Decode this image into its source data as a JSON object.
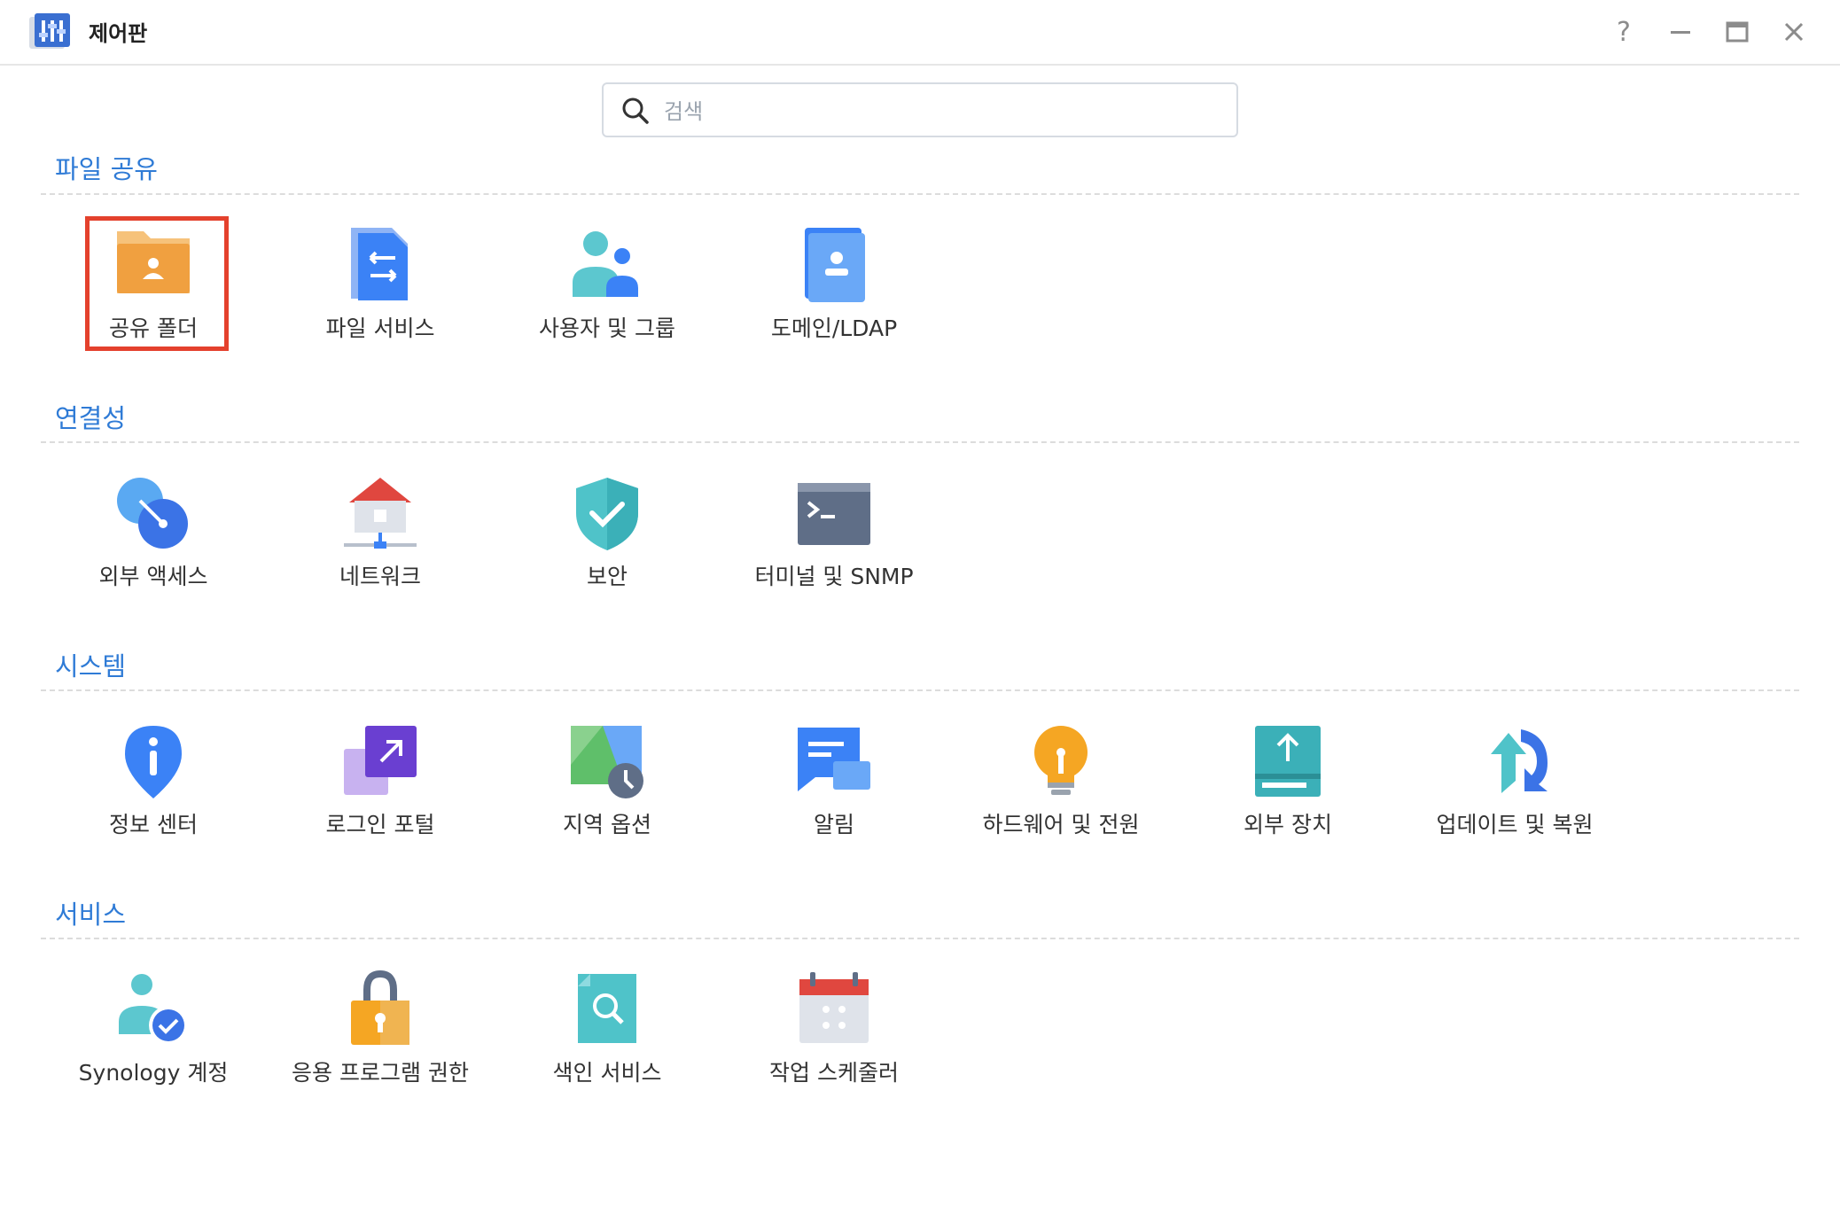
{
  "window": {
    "title": "제어판",
    "controls": [
      "help",
      "minimize",
      "maximize",
      "close"
    ],
    "help_label": "?"
  },
  "search": {
    "placeholder": "검색",
    "value": ""
  },
  "sections": [
    {
      "title": "파일 공유",
      "items": [
        {
          "label": "공유 폴더",
          "icon": "shared-folder-icon",
          "selected": true
        },
        {
          "label": "파일 서비스",
          "icon": "file-services-icon"
        },
        {
          "label": "사용자 및 그룹",
          "icon": "user-group-icon"
        },
        {
          "label": "도메인/LDAP",
          "icon": "domain-ldap-icon"
        }
      ]
    },
    {
      "title": "연결성",
      "items": [
        {
          "label": "외부 액세스",
          "icon": "external-access-icon"
        },
        {
          "label": "네트워크",
          "icon": "network-icon"
        },
        {
          "label": "보안",
          "icon": "security-shield-icon"
        },
        {
          "label": "터미널 및 SNMP",
          "icon": "terminal-icon"
        }
      ]
    },
    {
      "title": "시스템",
      "items": [
        {
          "label": "정보 센터",
          "icon": "info-center-icon"
        },
        {
          "label": "로그인 포털",
          "icon": "login-portal-icon"
        },
        {
          "label": "지역 옵션",
          "icon": "regional-options-icon"
        },
        {
          "label": "알림",
          "icon": "notification-icon"
        },
        {
          "label": "하드웨어 및 전원",
          "icon": "hardware-power-icon"
        },
        {
          "label": "외부 장치",
          "icon": "external-devices-icon"
        },
        {
          "label": "업데이트 및 복원",
          "icon": "update-restore-icon"
        }
      ]
    },
    {
      "title": "서비스",
      "items": [
        {
          "label": "Synology 계정",
          "icon": "synology-account-icon"
        },
        {
          "label": "응용 프로그램 권한",
          "icon": "application-privileges-icon"
        },
        {
          "label": "색인 서비스",
          "icon": "indexing-service-icon"
        },
        {
          "label": "작업 스케줄러",
          "icon": "task-scheduler-icon"
        }
      ]
    }
  ],
  "colors": {
    "accent": "#2f7bd6",
    "selection_border": "#e4412d",
    "folder_orange": "#f0a040",
    "blue": "#3b82f6",
    "teal": "#4fc3c9"
  }
}
